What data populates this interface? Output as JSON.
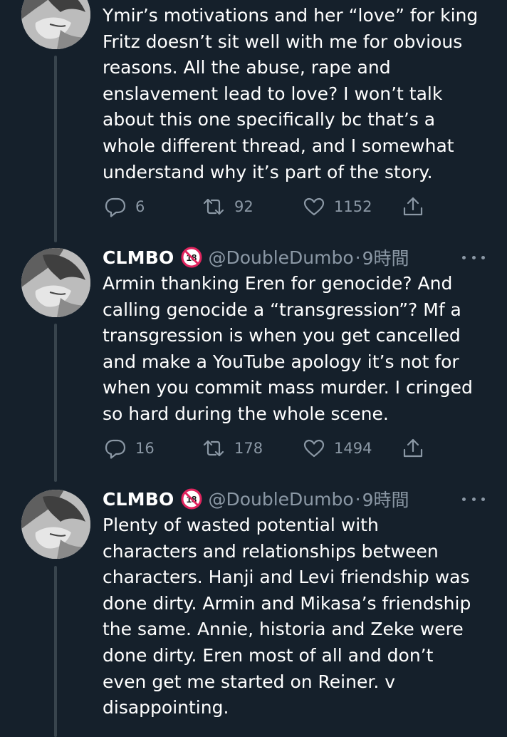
{
  "thread": {
    "tweets": [
      {
        "name": "",
        "badge": "no-under-18-icon",
        "handle": "",
        "time": "",
        "lines": [
          "Ymir’s motivations and her “love” for king",
          "Fritz doesn’t sit well with me for obvious",
          "reasons. All the abuse, rape and",
          "enslavement lead to love? I won’t talk",
          "about this one specifically bc that’s a",
          "whole different thread, and I somewhat",
          "understand why it’s part of the story."
        ],
        "replies": "6",
        "retweets": "92",
        "likes": "1152"
      },
      {
        "name": "CLMBO",
        "badge": "no-under-18-icon",
        "handle": "@DoubleDumbo",
        "separator": "·",
        "time": "9時間",
        "lines": [
          "Armin thanking Eren for genocide? And",
          "calling genocide a “transgression”? Mf a",
          "transgression is when you get cancelled",
          "and make a YouTube apology it’s not for",
          "when you commit mass murder. I cringed",
          "so hard during the whole scene."
        ],
        "replies": "16",
        "retweets": "178",
        "likes": "1494"
      },
      {
        "name": "CLMBO",
        "badge": "no-under-18-icon",
        "handle": "@DoubleDumbo",
        "separator": "·",
        "time": "9時間",
        "lines": [
          "Plenty of wasted potential with",
          "characters and relationships between",
          "characters. Hanji and Levi friendship was",
          "done dirty. Armin and Mikasa’s friendship",
          "the same. Annie, historia and Zeke were",
          "done dirty. Eren most of all and don’t",
          "even get me started on Reiner. v",
          "disappointing."
        ]
      }
    ]
  },
  "colors": {
    "background": "#15202b",
    "text": "#ffffff",
    "secondary": "#8b98a5",
    "thread_line": "#38444d",
    "badge_red": "#e0245e"
  },
  "icons": {
    "reply": "reply-icon",
    "retweet": "retweet-icon",
    "like": "like-icon",
    "share": "share-icon",
    "more": "more-icon"
  }
}
